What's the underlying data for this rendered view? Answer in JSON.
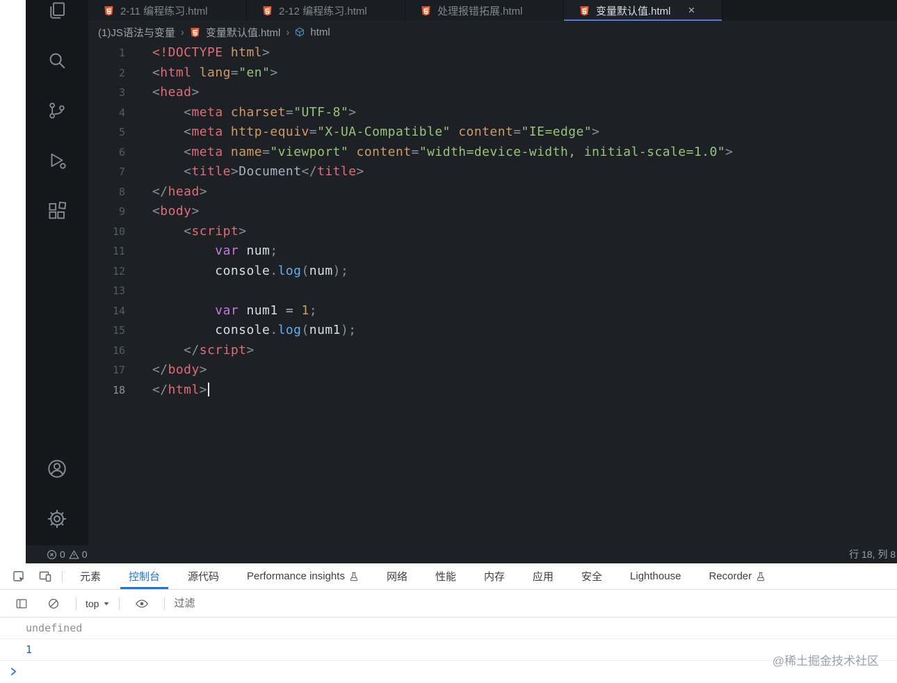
{
  "colors": {
    "editor_background": "#1d2126",
    "activity_bar_background": "#15171b",
    "active_tab_underline": "#4d7cd6",
    "devtools_accent": "#1a73e8",
    "html_icon_orange": "#e44d26"
  },
  "vscode": {
    "activity_bar": {
      "icons": [
        "files-icon",
        "search-icon",
        "source-control-icon",
        "run-debug-icon",
        "extensions-icon",
        "account-icon",
        "settings-icon"
      ]
    },
    "tabs": [
      {
        "label": "2-11 编程练习.html"
      },
      {
        "label": "2-12 编程练习.html"
      },
      {
        "label": "处理报错拓展.html"
      },
      {
        "label": "变量默认值.html",
        "active": true
      }
    ],
    "breadcrumb": {
      "folder": "(1)JS语法与变量",
      "file": "变量默认值.html",
      "symbol": "html"
    },
    "editor": {
      "lines": [
        {
          "n": "1",
          "ind": 0,
          "toks": [
            [
              "tag",
              "<!DOCTYPE"
            ],
            [
              "plain",
              " "
            ],
            [
              "attr",
              "html"
            ],
            [
              "punc",
              ">"
            ]
          ]
        },
        {
          "n": "2",
          "ind": 0,
          "toks": [
            [
              "punc",
              "<"
            ],
            [
              "tag",
              "html"
            ],
            [
              "plain",
              " "
            ],
            [
              "attr",
              "lang"
            ],
            [
              "punc",
              "="
            ],
            [
              "str",
              "\"en\""
            ],
            [
              "punc",
              ">"
            ]
          ]
        },
        {
          "n": "3",
          "ind": 0,
          "toks": [
            [
              "punc",
              "<"
            ],
            [
              "tag",
              "head"
            ],
            [
              "punc",
              ">"
            ]
          ]
        },
        {
          "n": "4",
          "ind": 4,
          "toks": [
            [
              "punc",
              "<"
            ],
            [
              "tag",
              "meta"
            ],
            [
              "plain",
              " "
            ],
            [
              "attr",
              "charset"
            ],
            [
              "punc",
              "="
            ],
            [
              "str",
              "\"UTF-8\""
            ],
            [
              "punc",
              ">"
            ]
          ]
        },
        {
          "n": "5",
          "ind": 4,
          "toks": [
            [
              "punc",
              "<"
            ],
            [
              "tag",
              "meta"
            ],
            [
              "plain",
              " "
            ],
            [
              "attr",
              "http-equiv"
            ],
            [
              "punc",
              "="
            ],
            [
              "str",
              "\"X-UA-Compatible\""
            ],
            [
              "plain",
              " "
            ],
            [
              "attr",
              "content"
            ],
            [
              "punc",
              "="
            ],
            [
              "str",
              "\"IE=edge\""
            ],
            [
              "punc",
              ">"
            ]
          ]
        },
        {
          "n": "6",
          "ind": 4,
          "toks": [
            [
              "punc",
              "<"
            ],
            [
              "tag",
              "meta"
            ],
            [
              "plain",
              " "
            ],
            [
              "attr",
              "name"
            ],
            [
              "punc",
              "="
            ],
            [
              "str",
              "\"viewport\""
            ],
            [
              "plain",
              " "
            ],
            [
              "attr",
              "content"
            ],
            [
              "punc",
              "="
            ],
            [
              "str",
              "\"width=device-width, initial-scale=1.0\""
            ],
            [
              "punc",
              ">"
            ]
          ]
        },
        {
          "n": "7",
          "ind": 4,
          "toks": [
            [
              "punc",
              "<"
            ],
            [
              "tag",
              "title"
            ],
            [
              "punc",
              ">"
            ],
            [
              "plain",
              "Document"
            ],
            [
              "punc",
              "</"
            ],
            [
              "tag",
              "title"
            ],
            [
              "punc",
              ">"
            ]
          ]
        },
        {
          "n": "8",
          "ind": 0,
          "toks": [
            [
              "punc",
              "</"
            ],
            [
              "tag",
              "head"
            ],
            [
              "punc",
              ">"
            ]
          ]
        },
        {
          "n": "9",
          "ind": 0,
          "toks": [
            [
              "punc",
              "<"
            ],
            [
              "tag",
              "body"
            ],
            [
              "punc",
              ">"
            ]
          ]
        },
        {
          "n": "10",
          "ind": 4,
          "toks": [
            [
              "punc",
              "<"
            ],
            [
              "tag",
              "script"
            ],
            [
              "punc",
              ">"
            ]
          ]
        },
        {
          "n": "11",
          "ind": 8,
          "toks": [
            [
              "kw",
              "var"
            ],
            [
              "plain",
              " "
            ],
            [
              "var",
              "num"
            ],
            [
              "punc",
              ";"
            ]
          ]
        },
        {
          "n": "12",
          "ind": 8,
          "toks": [
            [
              "var",
              "console"
            ],
            [
              "punc",
              "."
            ],
            [
              "fn",
              "log"
            ],
            [
              "punc",
              "("
            ],
            [
              "var",
              "num"
            ],
            [
              "punc",
              ")"
            ],
            [
              "punc",
              ";"
            ]
          ]
        },
        {
          "n": "13",
          "ind": 0,
          "toks": []
        },
        {
          "n": "14",
          "ind": 8,
          "toks": [
            [
              "kw",
              "var"
            ],
            [
              "plain",
              " "
            ],
            [
              "var",
              "num1"
            ],
            [
              "plain",
              " "
            ],
            [
              "op",
              "="
            ],
            [
              "plain",
              " "
            ],
            [
              "num",
              "1"
            ],
            [
              "punc",
              ";"
            ]
          ]
        },
        {
          "n": "15",
          "ind": 8,
          "toks": [
            [
              "var",
              "console"
            ],
            [
              "punc",
              "."
            ],
            [
              "fn",
              "log"
            ],
            [
              "punc",
              "("
            ],
            [
              "var",
              "num1"
            ],
            [
              "punc",
              ")"
            ],
            [
              "punc",
              ";"
            ]
          ]
        },
        {
          "n": "16",
          "ind": 4,
          "toks": [
            [
              "punc",
              "</"
            ],
            [
              "tag",
              "script"
            ],
            [
              "punc",
              ">"
            ]
          ]
        },
        {
          "n": "17",
          "ind": 0,
          "toks": [
            [
              "punc",
              "</"
            ],
            [
              "tag",
              "body"
            ],
            [
              "punc",
              ">"
            ]
          ]
        },
        {
          "n": "18",
          "ind": 0,
          "active": true,
          "cursor": true,
          "toks": [
            [
              "punc",
              "</"
            ],
            [
              "tag",
              "html"
            ],
            [
              "punc",
              ">"
            ]
          ]
        }
      ]
    },
    "status_bar": {
      "errors": "0",
      "warnings": "0",
      "position": "行 18, 列 8"
    }
  },
  "devtools": {
    "tabs": [
      {
        "id": "elements",
        "label": "元素"
      },
      {
        "id": "console",
        "label": "控制台",
        "active": true
      },
      {
        "id": "sources",
        "label": "源代码"
      },
      {
        "id": "performance-insights",
        "label": "Performance insights",
        "beaker": true
      },
      {
        "id": "network",
        "label": "网络"
      },
      {
        "id": "performance",
        "label": "性能"
      },
      {
        "id": "memory",
        "label": "内存"
      },
      {
        "id": "application",
        "label": "应用"
      },
      {
        "id": "security",
        "label": "安全"
      },
      {
        "id": "lighthouse",
        "label": "Lighthouse"
      },
      {
        "id": "recorder",
        "label": "Recorder",
        "beaker": true
      }
    ],
    "toolbar": {
      "context": "top",
      "filter_placeholder": "过滤"
    },
    "console_rows": [
      {
        "text": "undefined",
        "type": "undefined"
      },
      {
        "text": "1",
        "type": "number"
      }
    ],
    "watermark": "@稀土掘金技术社区"
  }
}
